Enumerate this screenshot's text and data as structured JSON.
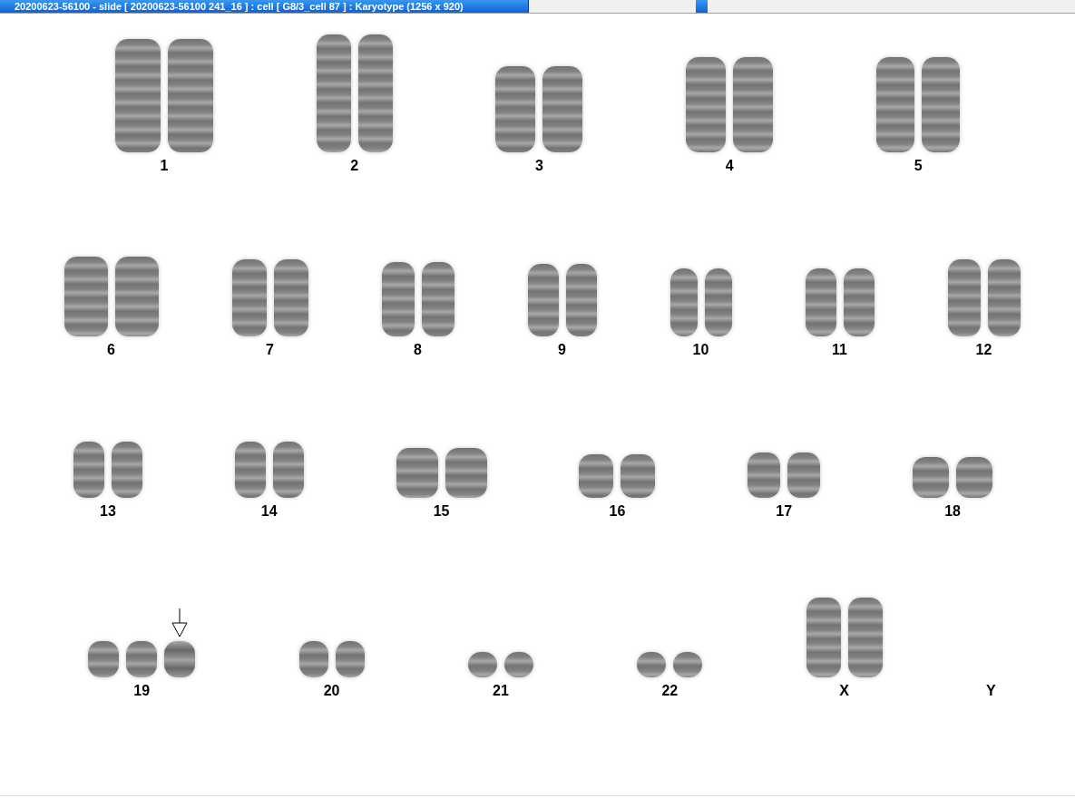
{
  "window": {
    "title": "20200623-56100 - slide [ 20200623-56100 241_16 ] : cell [ G8/3_cell 87 ] : Karyotype  (1256 x 920)"
  },
  "rows": [
    {
      "groups": [
        {
          "label": "1",
          "copies": [
            {
              "marked": false
            },
            {
              "marked": false
            }
          ]
        },
        {
          "label": "2",
          "copies": [
            {
              "marked": false
            },
            {
              "marked": false
            }
          ]
        },
        {
          "label": "3",
          "copies": [
            {
              "marked": false
            },
            {
              "marked": false
            }
          ]
        },
        {
          "label": "4",
          "copies": [
            {
              "marked": false
            },
            {
              "marked": false
            }
          ]
        },
        {
          "label": "5",
          "copies": [
            {
              "marked": false
            },
            {
              "marked": false
            }
          ]
        }
      ]
    },
    {
      "groups": [
        {
          "label": "6",
          "copies": [
            {
              "marked": false
            },
            {
              "marked": false
            }
          ]
        },
        {
          "label": "7",
          "copies": [
            {
              "marked": false
            },
            {
              "marked": false
            }
          ]
        },
        {
          "label": "8",
          "copies": [
            {
              "marked": false
            },
            {
              "marked": false
            }
          ]
        },
        {
          "label": "9",
          "copies": [
            {
              "marked": false
            },
            {
              "marked": false
            }
          ]
        },
        {
          "label": "10",
          "copies": [
            {
              "marked": false
            },
            {
              "marked": false
            }
          ]
        },
        {
          "label": "11",
          "copies": [
            {
              "marked": false
            },
            {
              "marked": false
            }
          ]
        },
        {
          "label": "12",
          "copies": [
            {
              "marked": false
            },
            {
              "marked": false
            }
          ]
        }
      ]
    },
    {
      "groups": [
        {
          "label": "13",
          "copies": [
            {
              "marked": false
            },
            {
              "marked": false
            }
          ]
        },
        {
          "label": "14",
          "copies": [
            {
              "marked": false
            },
            {
              "marked": false
            }
          ]
        },
        {
          "label": "15",
          "copies": [
            {
              "marked": false
            },
            {
              "marked": false
            }
          ]
        },
        {
          "label": "16",
          "copies": [
            {
              "marked": false
            },
            {
              "marked": false
            }
          ]
        },
        {
          "label": "17",
          "copies": [
            {
              "marked": false
            },
            {
              "marked": false
            }
          ]
        },
        {
          "label": "18",
          "copies": [
            {
              "marked": false
            },
            {
              "marked": false
            }
          ]
        }
      ]
    },
    {
      "groups": [
        {
          "label": "19",
          "copies": [
            {
              "marked": false
            },
            {
              "marked": false
            },
            {
              "marked": true
            }
          ]
        },
        {
          "label": "20",
          "copies": [
            {
              "marked": false
            },
            {
              "marked": false
            }
          ]
        },
        {
          "label": "21",
          "copies": [
            {
              "marked": false
            },
            {
              "marked": false
            }
          ]
        },
        {
          "label": "22",
          "copies": [
            {
              "marked": false
            },
            {
              "marked": false
            }
          ]
        },
        {
          "label": "X",
          "copies": [
            {
              "marked": false
            },
            {
              "marked": false
            }
          ]
        },
        {
          "label": "Y"
        }
      ]
    }
  ]
}
